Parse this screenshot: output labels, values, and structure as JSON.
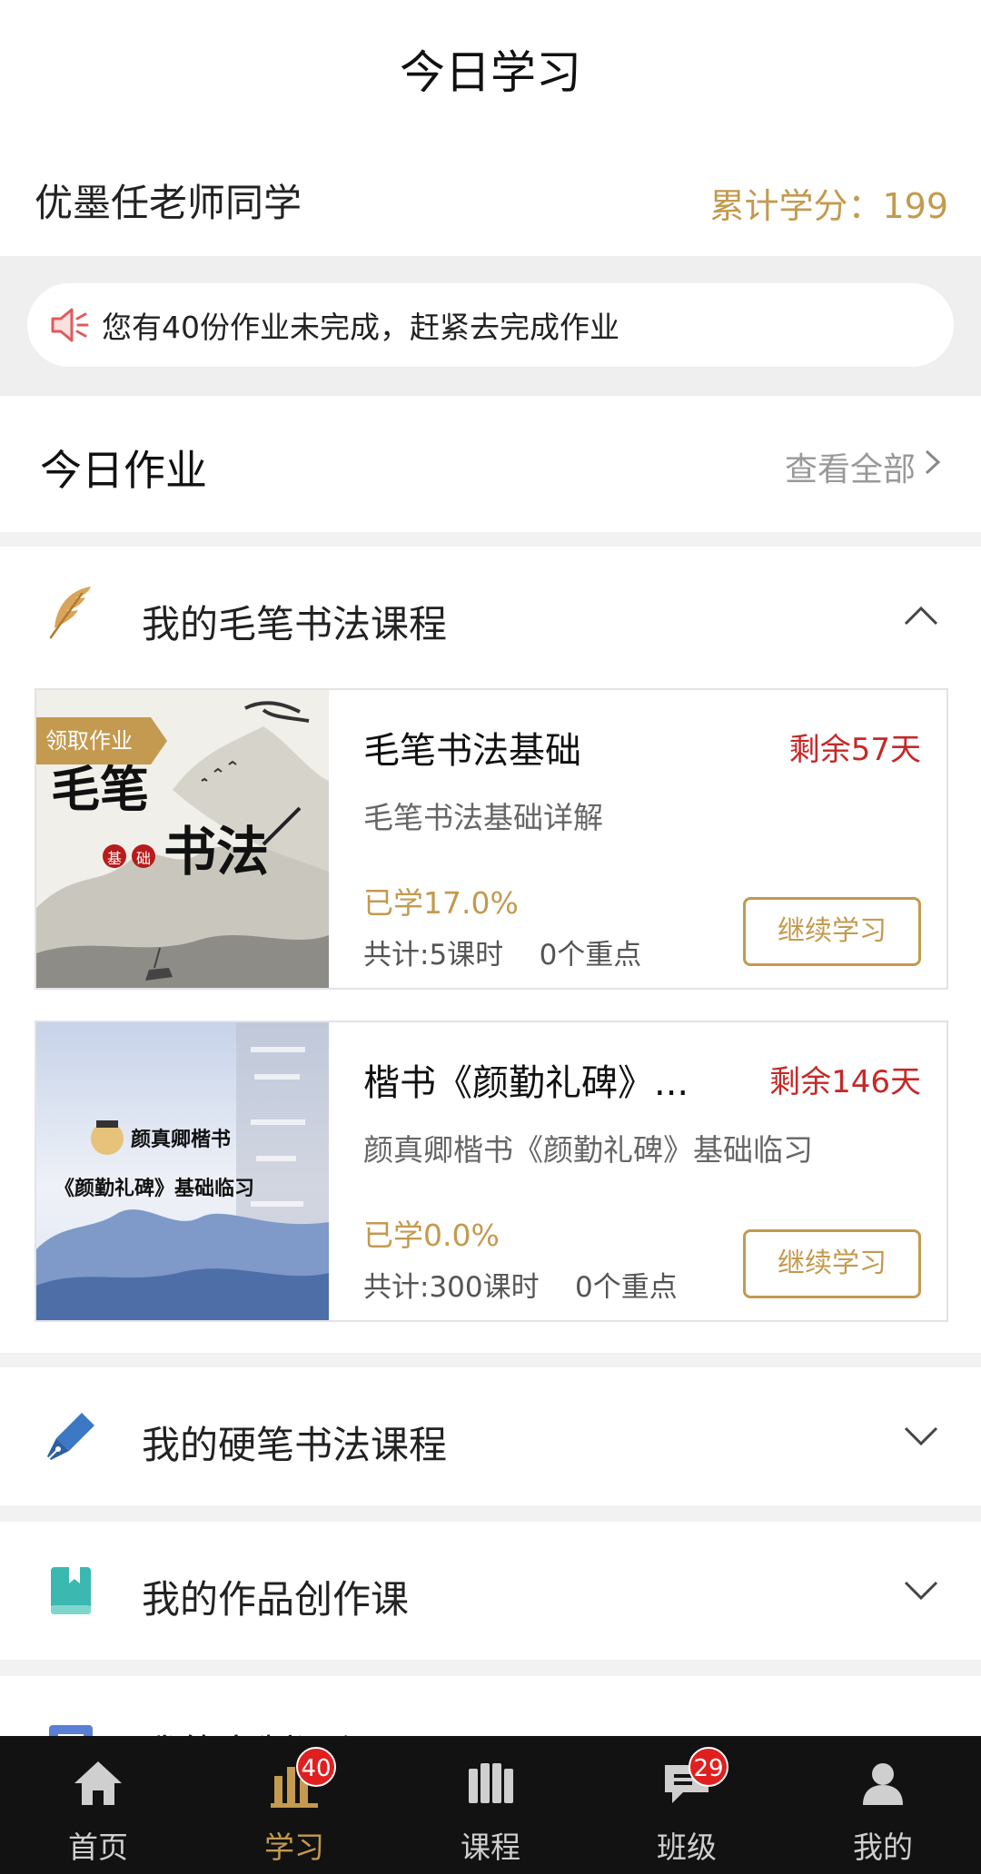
{
  "header": {
    "title": "今日学习",
    "user_name": "优墨任老师同学",
    "credits_label": "累计学分：",
    "credits_value": "199"
  },
  "notice": {
    "text": "您有40份作业未完成，赶紧去完成作业",
    "icon": "speaker-icon"
  },
  "homework": {
    "label": "今日作业",
    "view_all": "查看全部"
  },
  "sections": [
    {
      "label": "我的毛笔书法课程",
      "icon": "feather-icon",
      "expanded": true
    },
    {
      "label": "我的硬笔书法课程",
      "icon": "pen-icon",
      "expanded": false
    },
    {
      "label": "我的作品创作课",
      "icon": "book-icon",
      "expanded": false
    },
    {
      "label": "我的定制课程",
      "icon": "custom-course-icon",
      "expanded": false
    }
  ],
  "courses": [
    {
      "ribbon": "领取作业",
      "thumb_text_1": "毛笔",
      "thumb_text_2": "书法",
      "thumb_stamp_1": "基",
      "thumb_stamp_2": "础",
      "name": "毛笔书法基础",
      "remaining": "剩余57天",
      "description": "毛笔书法基础详解",
      "progress": "已学17.0%",
      "progress_value": 0.17,
      "meta": "共计:5课时    0个重点",
      "button": "继续学习"
    },
    {
      "thumb_text_1": "颜真卿楷书",
      "thumb_text_2": "《颜勤礼碑》基础临习",
      "name": "楷书《颜勤礼碑》...",
      "remaining": "剩余146天",
      "description": "颜真卿楷书《颜勤礼碑》基础临习",
      "progress": "已学0.0%",
      "progress_value": 0.0,
      "meta": "共计:300课时    0个重点",
      "button": "继续学习"
    }
  ],
  "tabbar": [
    {
      "label": "首页",
      "icon": "home-icon",
      "active": false
    },
    {
      "label": "学习",
      "icon": "study-icon",
      "active": true,
      "badge": "40"
    },
    {
      "label": "课程",
      "icon": "courses-icon",
      "active": false
    },
    {
      "label": "班级",
      "icon": "class-icon",
      "active": false,
      "badge": "29"
    },
    {
      "label": "我的",
      "icon": "profile-icon",
      "active": false
    }
  ],
  "colors": {
    "accent": "#c39a4f",
    "warning": "#c62828",
    "badge": "#e02020",
    "tabbar_bg": "#121212"
  }
}
